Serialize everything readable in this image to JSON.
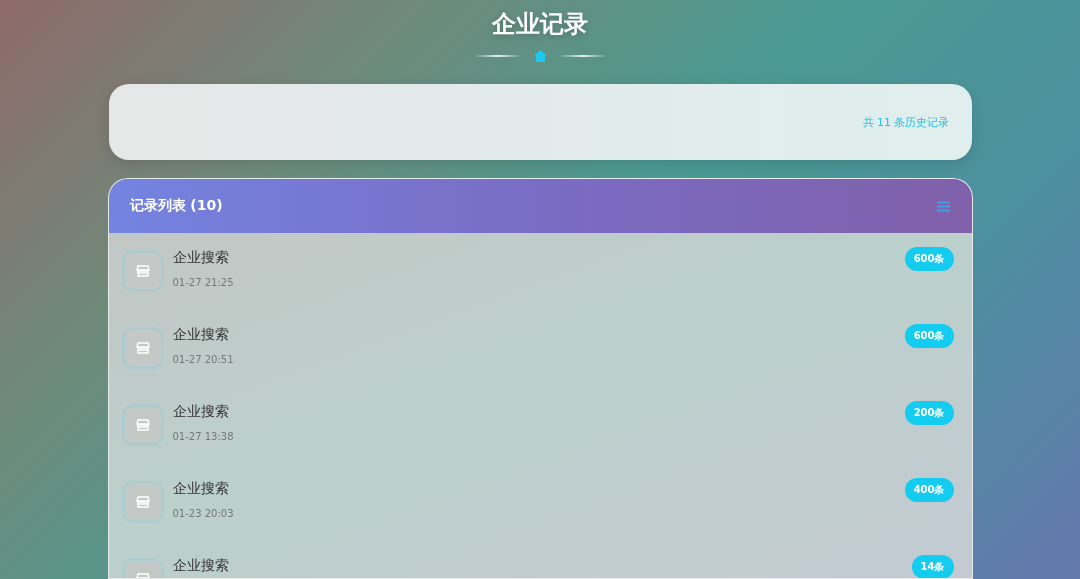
{
  "page_title": "企业记录",
  "summary": {
    "text": "共 11 条历史记录"
  },
  "list": {
    "title": "记录列表 (10)",
    "items": [
      {
        "title": "企业搜索",
        "time": "01-27 21:25",
        "count": "600条"
      },
      {
        "title": "企业搜索",
        "time": "01-27 20:51",
        "count": "600条"
      },
      {
        "title": "企业搜索",
        "time": "01-27 13:38",
        "count": "200条"
      },
      {
        "title": "企业搜索",
        "time": "01-23 20:03",
        "count": "400条"
      },
      {
        "title": "企业搜索",
        "count": "14条"
      }
    ]
  }
}
